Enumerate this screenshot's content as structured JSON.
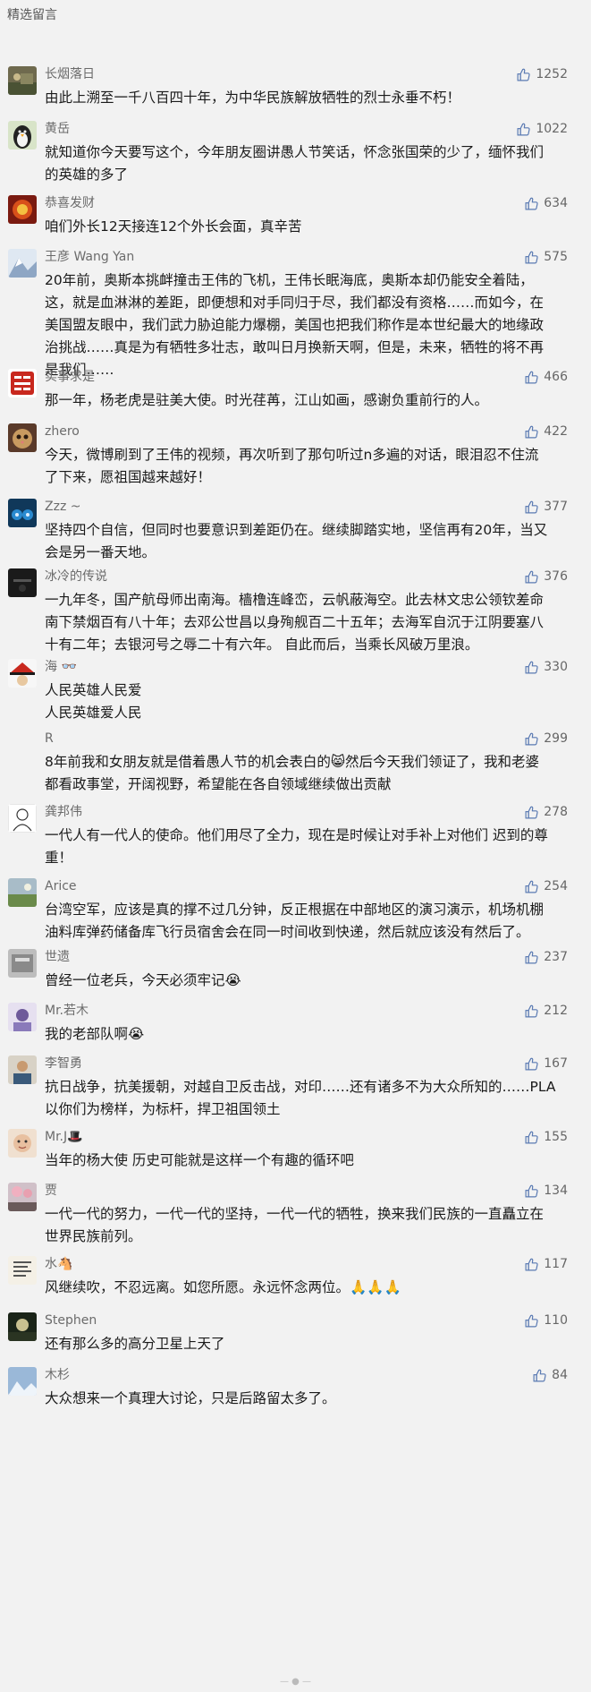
{
  "header": {
    "title": "精选留言"
  },
  "comments": [
    {
      "author": "长烟落日",
      "likes": "1252",
      "text": "由此上溯至一千八百四十年，为中华民族解放牺牲的烈士永垂不朽！",
      "avatar": "landscape-avatar"
    },
    {
      "author": "黄岳",
      "likes": "1022",
      "text": "就知道你今天要写这个，今年朋友圈讲愚人节笑话，怀念张国荣的少了，缅怀我们\n的英雄的多了",
      "avatar": "penguin-avatar"
    },
    {
      "author": "恭喜发财",
      "likes": "634",
      "text": "咱们外长12天接连12个外长会面，真辛苦",
      "avatar": "fire-avatar"
    },
    {
      "author": "王彦 Wang Yan",
      "likes": "575",
      "text": "20年前，奥斯本挑衅撞击王伟的飞机，王伟长眠海底，奥斯本却仍能安全着陆，\n这，就是血淋淋的差距，即便想和对手同归于尽，我们都没有资格……而如今，在\n美国盟友眼中，我们武力胁迫能力爆棚，美国也把我们称作是本世纪最大的地缘政\n治挑战……真是为有牺牲多壮志，敢叫日月换新天啊，但是，未来，牺牲的将不再\n是我们……",
      "avatar": "snow-avatar"
    },
    {
      "author": "实事求是",
      "likes": "466",
      "text": "那一年，杨老虎是驻美大使。时光荏苒，江山如画，感谢负重前行的人。",
      "avatar": "seal-avatar"
    },
    {
      "author": "zhero",
      "likes": "422",
      "text": "今天，微博刷到了王伟的视频，再次听到了那句听过n多遍的对话，眼泪忍不住流\n了下来，愿祖国越来越好！",
      "avatar": "cat-avatar"
    },
    {
      "author": "Zzz ~",
      "likes": "377",
      "text": "坚持四个自信，但同时也要意识到差距仍在。继续脚踏实地，坚信再有20年，当又\n会是另一番天地。",
      "avatar": "blue-avatar"
    },
    {
      "author": "冰冷的传说",
      "likes": "376",
      "text": "一九年冬，国产航母师出南海。樯橹连峰峦，云帆蔽海空。此去林文忠公领钦差命\n南下禁烟百有八十年；去邓公世昌以身殉舰百二十五年；去海军自沉于江阴要塞八\n十有二年；去银河号之辱二十有六年。 自此而后，当乘长风破万里浪。",
      "avatar": "dark-avatar"
    },
    {
      "author": "海 👓",
      "likes": "330",
      "text": "人民英雄人民爱\n人民英雄爱人民",
      "avatar": "hat-avatar"
    },
    {
      "author": "R",
      "likes": "299",
      "text": "8年前我和女朋友就是借着愚人节的机会表白的😸然后今天我们领证了，我和老婆\n都看政事堂，开阔视野，希望能在各自领域继续做出贡献",
      "avatar": "none"
    },
    {
      "author": "龚邦伟",
      "likes": "278",
      "text": "一代人有一代人的使命。他们用尽了全力，现在是时候让对手补上对他们 迟到的尊\n重！",
      "avatar": "sketch-avatar"
    },
    {
      "author": "Arice",
      "likes": "254",
      "text": "台湾空军，应该是真的撑不过几分钟，反正根据在中部地区的演习演示，机场机棚\n油料库弹药储备库飞行员宿舍会在同一时间收到快递，然后就应该没有然后了。",
      "avatar": "field-avatar"
    },
    {
      "author": "世遗",
      "likes": "237",
      "text": "曾经一位老兵，今天必须牢记😭",
      "avatar": "gray-avatar"
    },
    {
      "author": "Mr.若木",
      "likes": "212",
      "text": "我的老部队啊😭",
      "avatar": "purple-avatar"
    },
    {
      "author": "李智勇",
      "likes": "167",
      "text": "抗日战争，抗美援朝，对越自卫反击战，对印……还有诸多不为大众所知的……PLA\n以你们为榜样，为标杆，捍卫祖国领土",
      "avatar": "person-avatar"
    },
    {
      "author": "Mr.J🎩",
      "likes": "155",
      "text": "当年的杨大使 历史可能就是这样一个有趣的循环吧",
      "avatar": "face-avatar"
    },
    {
      "author": "贾",
      "likes": "134",
      "text": "一代一代的努力，一代一代的坚持，一代一代的牺牲，换来我们民族的一直矗立在\n世界民族前列。",
      "avatar": "blossom-avatar"
    },
    {
      "author": "水🐴",
      "likes": "117",
      "text": "风继续吹，不忍远离。如您所愿。永远怀念两位。🙏🙏🙏",
      "avatar": "text-avatar"
    },
    {
      "author": "Stephen",
      "likes": "110",
      "text": "还有那么多的高分卫星上天了",
      "avatar": "night-avatar"
    },
    {
      "author": "木杉",
      "likes": "84",
      "text": "大众想来一个真理大讨论，只是后路留太多了。",
      "avatar": "snowfield-avatar"
    }
  ]
}
